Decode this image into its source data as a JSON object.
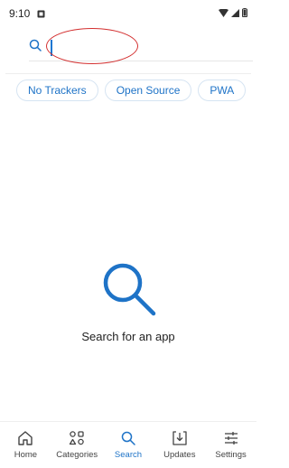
{
  "status_bar": {
    "time": "9:10"
  },
  "search": {
    "placeholder": "",
    "value": ""
  },
  "filters": [
    {
      "label": "No Trackers"
    },
    {
      "label": "Open Source"
    },
    {
      "label": "PWA"
    }
  ],
  "empty_state": {
    "message": "Search for an app",
    "icon": "search-icon"
  },
  "bottom_nav": {
    "items": [
      {
        "label": "Home",
        "icon": "home-icon",
        "active": false
      },
      {
        "label": "Categories",
        "icon": "categories-icon",
        "active": false
      },
      {
        "label": "Search",
        "icon": "search-icon",
        "active": true
      },
      {
        "label": "Updates",
        "icon": "updates-icon",
        "active": false
      },
      {
        "label": "Settings",
        "icon": "settings-icon",
        "active": false
      }
    ]
  },
  "colors": {
    "accent": "#1e73c7",
    "annotation": "#d32f2f"
  }
}
